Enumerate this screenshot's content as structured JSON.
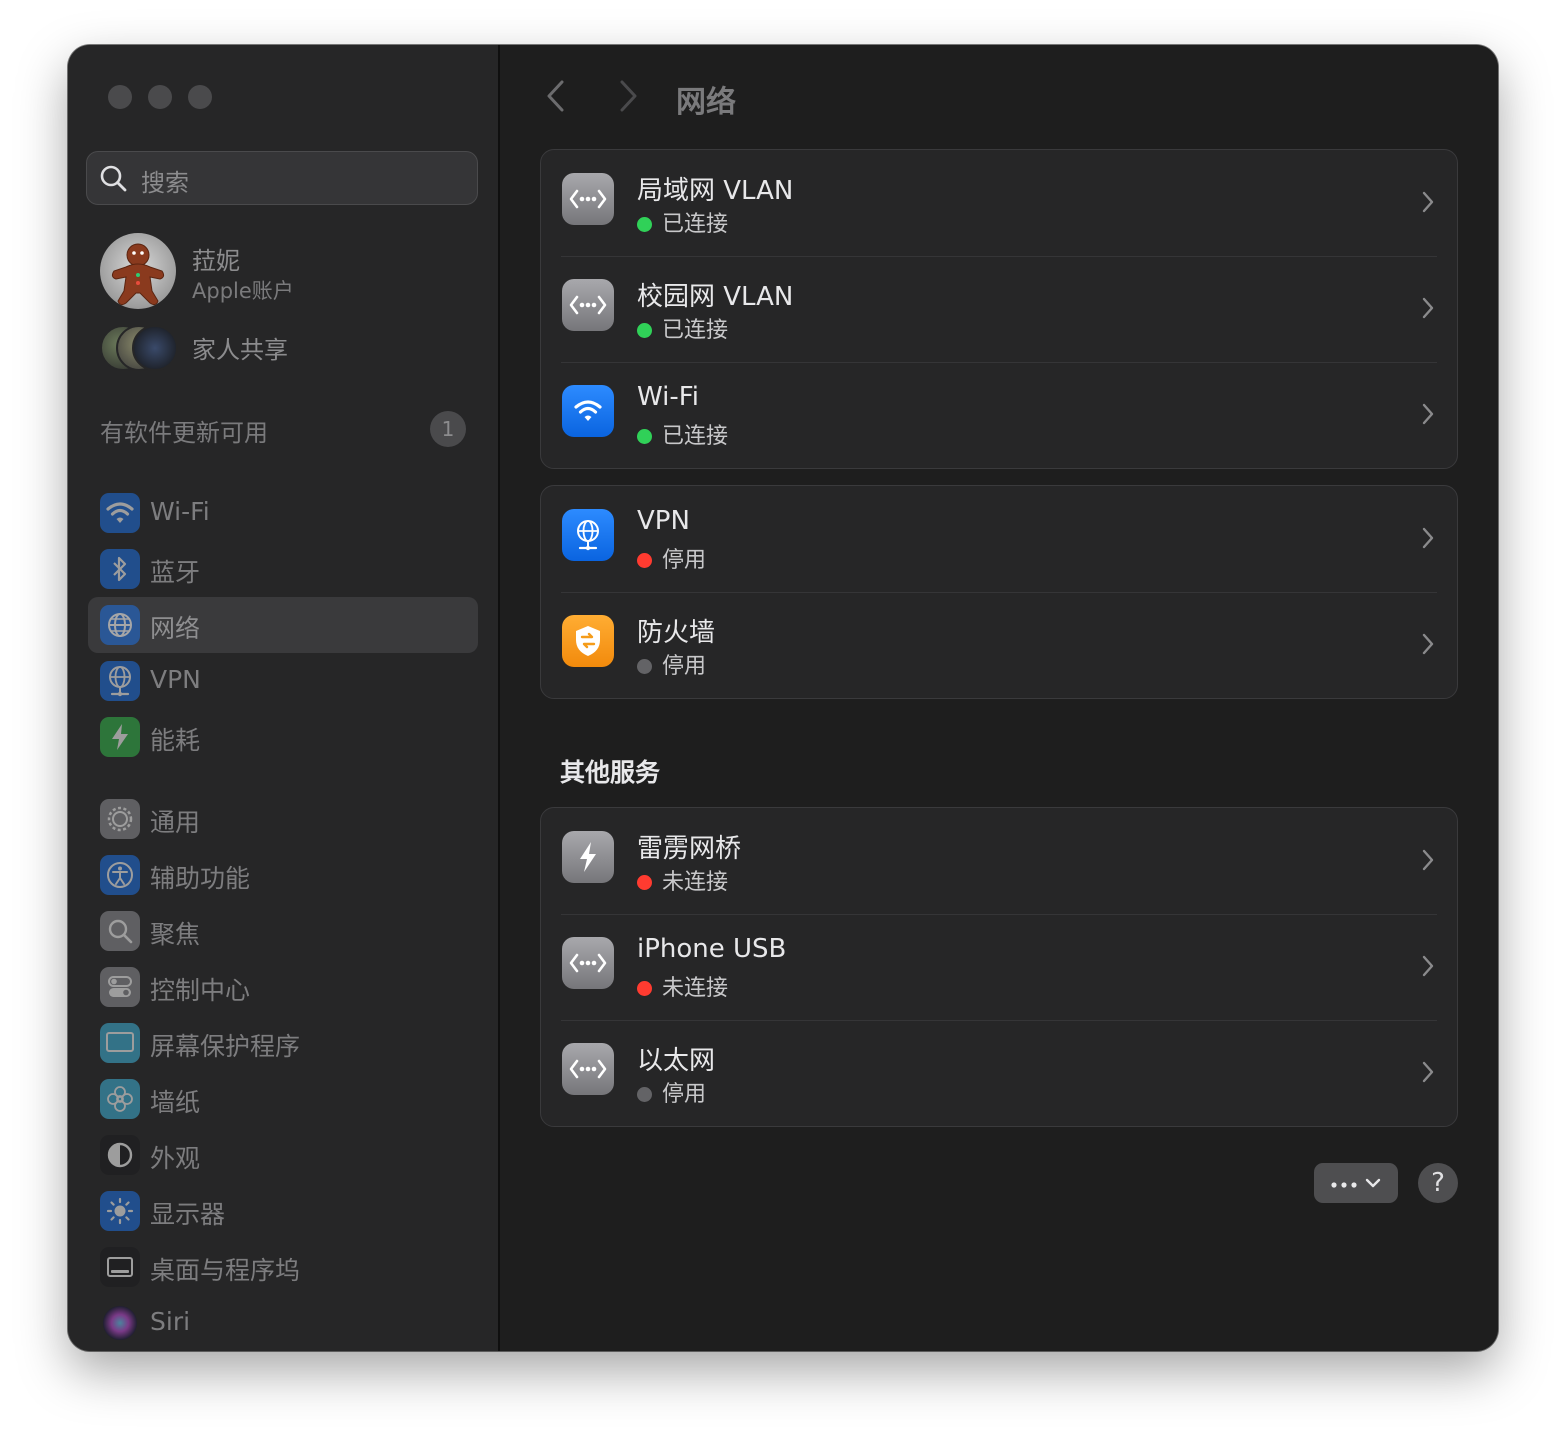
{
  "window": {
    "title": "网络"
  },
  "sidebar": {
    "search_placeholder": "搜索",
    "account": {
      "name": "菈妮",
      "subtitle": "Apple账户"
    },
    "family_label": "家人共享",
    "update_label": "有软件更新可用",
    "update_count": "1",
    "items": [
      {
        "label": "Wi-Fi",
        "icon": "wifi-icon",
        "color": "#1e6fe0"
      },
      {
        "label": "蓝牙",
        "icon": "bluetooth-icon",
        "color": "#1e6fe0"
      },
      {
        "label": "网络",
        "icon": "globe-icon",
        "color": "#1e6fe0",
        "selected": true
      },
      {
        "label": "VPN",
        "icon": "vpn-globe-icon",
        "color": "#1e6fe0"
      },
      {
        "label": "能耗",
        "icon": "battery-bolt-icon",
        "color": "#34b64a"
      },
      {
        "label": "通用",
        "icon": "gear-icon",
        "color": "#8e8e93"
      },
      {
        "label": "辅助功能",
        "icon": "accessibility-icon",
        "color": "#1e6fe0"
      },
      {
        "label": "聚焦",
        "icon": "magnifier-icon",
        "color": "#8e8e93"
      },
      {
        "label": "控制中心",
        "icon": "toggles-icon",
        "color": "#8e8e93"
      },
      {
        "label": "屏幕保护程序",
        "icon": "screensaver-icon",
        "color": "#3fb0d6"
      },
      {
        "label": "墙纸",
        "icon": "flower-icon",
        "color": "#3fb0d6"
      },
      {
        "label": "外观",
        "icon": "appearance-icon",
        "color": "#1c1c1e"
      },
      {
        "label": "显示器",
        "icon": "sun-icon",
        "color": "#1e6fe0"
      },
      {
        "label": "桌面与程序坞",
        "icon": "dock-icon",
        "color": "#1c1c1e"
      },
      {
        "label": "Siri",
        "icon": "siri-icon",
        "color": "#7a3bd1"
      }
    ]
  },
  "main": {
    "title": "网络",
    "groups": [
      {
        "rows": [
          {
            "title": "局域网 VLAN",
            "status": "已连接",
            "status_color": "#30d158",
            "icon": "ethernet-icon"
          },
          {
            "title": "校园网 VLAN",
            "status": "已连接",
            "status_color": "#30d158",
            "icon": "ethernet-icon"
          },
          {
            "title": "Wi-Fi",
            "status": "已连接",
            "status_color": "#30d158",
            "icon": "wifi-icon"
          }
        ]
      },
      {
        "rows": [
          {
            "title": "VPN",
            "status": "停用",
            "status_color": "#ff3b30",
            "icon": "vpn-globe-icon"
          },
          {
            "title": "防火墙",
            "status": "停用",
            "status_color": "#636366",
            "icon": "firewall-shield-icon"
          }
        ]
      },
      {
        "title": "其他服务",
        "rows": [
          {
            "title": "雷雳网桥",
            "status": "未连接",
            "status_color": "#ff3b30",
            "icon": "thunderbolt-icon"
          },
          {
            "title": "iPhone USB",
            "status": "未连接",
            "status_color": "#ff3b30",
            "icon": "ethernet-icon"
          },
          {
            "title": "以太网",
            "status": "停用",
            "status_color": "#636366",
            "icon": "ethernet-icon"
          }
        ]
      }
    ],
    "more_button": "···",
    "help_button": "?"
  }
}
